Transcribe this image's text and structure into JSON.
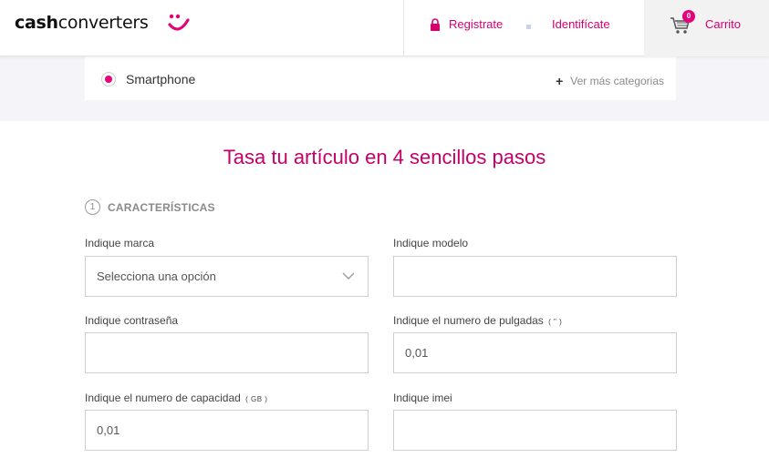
{
  "header": {
    "logo_cash": "cash",
    "logo_converters": "converters",
    "register_label": "Registrate",
    "login_label": "Identifícate",
    "cart_label": "Carrito",
    "cart_count": "0",
    "brand_color": "#e6007a"
  },
  "category": {
    "selected_label": "Smartphone",
    "more_label": "Ver más categorias"
  },
  "main": {
    "title": "Tasa tu artículo en 4 sencillos pasos",
    "step_number": "1",
    "step_label": "CARACTERÍSTICAS"
  },
  "form": {
    "marca": {
      "label": "Indique marca",
      "value": "Selecciona una opción"
    },
    "modelo": {
      "label": "Indique modelo",
      "value": ""
    },
    "contrasena": {
      "label": "Indique contraseña",
      "value": ""
    },
    "pulgadas": {
      "label": "Indique el numero de pulgadas",
      "unit": "( \" )",
      "value": "0,01"
    },
    "capacidad": {
      "label": "Indique el numero de capacidad",
      "unit": "( GB )",
      "value": "0,01"
    },
    "imei": {
      "label": "Indique imei",
      "value": ""
    }
  }
}
